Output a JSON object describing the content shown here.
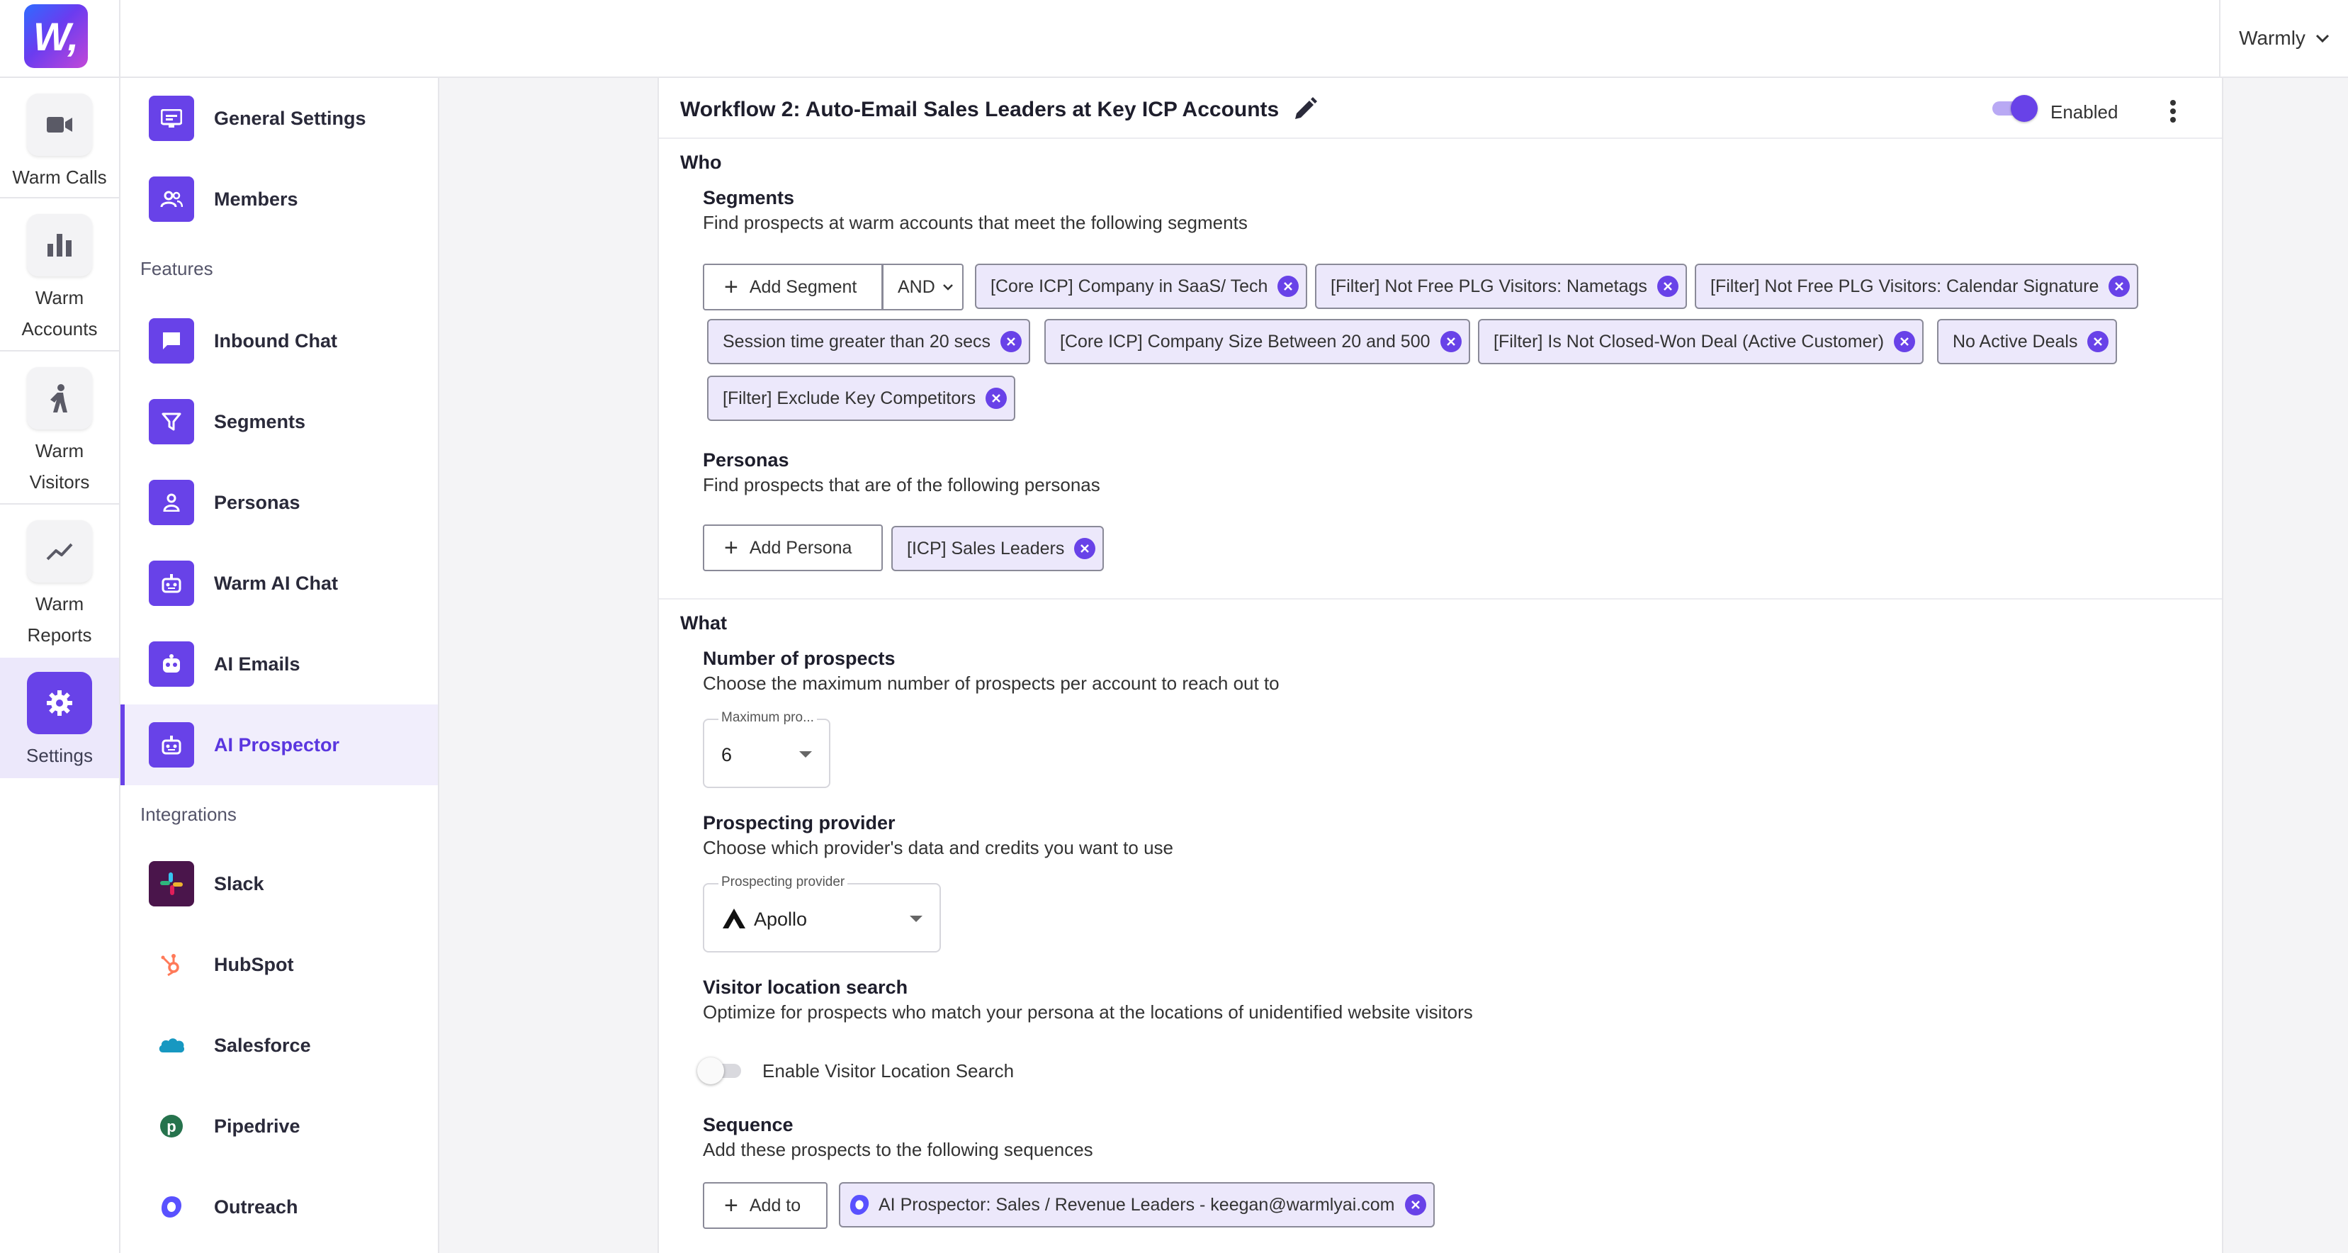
{
  "app": {
    "logo_text": "W,",
    "org_name": "Warmly"
  },
  "rail": {
    "items": [
      {
        "label": "Warm Calls",
        "icon": "video-camera-icon"
      },
      {
        "label": "Warm Accounts",
        "icon": "bar-chart-icon"
      },
      {
        "label": "Warm Visitors",
        "icon": "walking-person-icon"
      },
      {
        "label": "Warm Reports",
        "icon": "trend-line-icon"
      },
      {
        "label": "Settings",
        "icon": "gear-icon",
        "active": true
      }
    ]
  },
  "menu": {
    "top_items": [
      {
        "label": "General Settings",
        "icon": "settings-panel-icon"
      },
      {
        "label": "Members",
        "icon": "members-icon"
      }
    ],
    "features_heading": "Features",
    "features": [
      {
        "label": "Inbound Chat",
        "icon": "chat-bubble-icon"
      },
      {
        "label": "Segments",
        "icon": "filter-icon"
      },
      {
        "label": "Personas",
        "icon": "person-icon"
      },
      {
        "label": "Warm AI Chat",
        "icon": "robot-icon"
      },
      {
        "label": "AI Emails",
        "icon": "bot-face-icon"
      },
      {
        "label": "AI Prospector",
        "icon": "robot-icon",
        "active": true
      }
    ],
    "integrations_heading": "Integrations",
    "integrations": [
      {
        "label": "Slack",
        "icon": "slack-icon"
      },
      {
        "label": "HubSpot",
        "icon": "hubspot-icon"
      },
      {
        "label": "Salesforce",
        "icon": "salesforce-icon"
      },
      {
        "label": "Pipedrive",
        "icon": "pipedrive-icon"
      },
      {
        "label": "Outreach",
        "icon": "outreach-icon"
      }
    ]
  },
  "workflow": {
    "title": "Workflow 2: Auto-Email Sales Leaders at Key ICP Accounts",
    "enabled_label": "Enabled",
    "enabled": true
  },
  "who": {
    "label": "Who",
    "segments": {
      "heading": "Segments",
      "description": "Find prospects at warm accounts that meet the following segments",
      "add_label": "Add Segment",
      "operator": "AND",
      "chips": [
        "[Core ICP] Company in SaaS/ Tech",
        "[Filter] Not Free PLG Visitors: Nametags",
        "[Filter] Not Free PLG Visitors: Calendar Signature",
        "Session time greater than 20 secs",
        "[Core ICP] Company Size Between 20 and 500",
        "[Filter] Is Not Closed-Won Deal (Active Customer)",
        "No Active Deals",
        "[Filter] Exclude Key Competitors"
      ]
    },
    "personas": {
      "heading": "Personas",
      "description": "Find prospects that are of the following personas",
      "add_label": "Add Persona",
      "chips": [
        "[ICP] Sales Leaders"
      ]
    }
  },
  "what": {
    "label": "What",
    "prospects": {
      "heading": "Number of prospects",
      "description": "Choose the maximum number of prospects per account to reach out to",
      "field_label": "Maximum pro...",
      "value": "6"
    },
    "provider": {
      "heading": "Prospecting provider",
      "description": "Choose which provider's data and credits you want to use",
      "field_label": "Prospecting provider",
      "value": "Apollo"
    },
    "location": {
      "heading": "Visitor location search",
      "description": "Optimize for prospects who match your persona at the locations of unidentified website visitors",
      "toggle_label": "Enable Visitor Location Search",
      "enabled": false
    },
    "sequence": {
      "heading": "Sequence",
      "description": "Add these prospects to the following sequences",
      "add_label": "Add to",
      "chips": [
        "AI Prospector: Sales / Revenue Leaders - keegan@warmlyai.com"
      ]
    }
  },
  "colors": {
    "accent": "#6842e8",
    "chip_bg": "#ece8fb"
  }
}
